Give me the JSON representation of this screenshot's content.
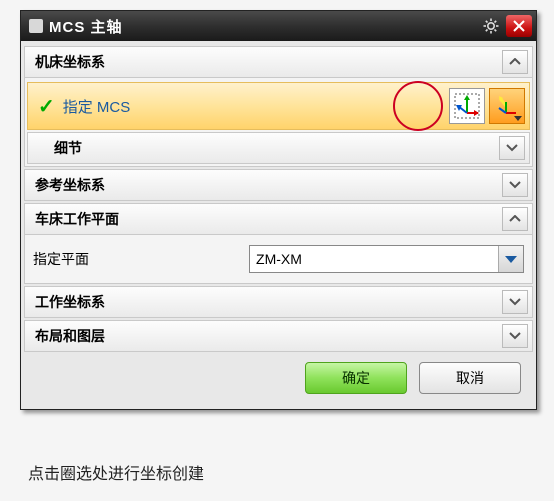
{
  "dialog": {
    "title": "MCS 主轴",
    "sections": {
      "machine_cs": {
        "label": "机床坐标系",
        "expanded": true
      },
      "specify_mcs": {
        "label": "指定 MCS"
      },
      "details": {
        "label": "细节",
        "expanded": false
      },
      "ref_cs": {
        "label": "参考坐标系",
        "expanded": false
      },
      "lathe_plane": {
        "label": "车床工作平面",
        "expanded": true
      },
      "specify_plane": {
        "label": "指定平面",
        "value": "ZM-XM"
      },
      "work_cs": {
        "label": "工作坐标系",
        "expanded": false
      },
      "layout_layer": {
        "label": "布局和图层",
        "expanded": false
      }
    },
    "buttons": {
      "ok": "确定",
      "cancel": "取消"
    }
  },
  "caption": "点击圈选处进行坐标创建"
}
